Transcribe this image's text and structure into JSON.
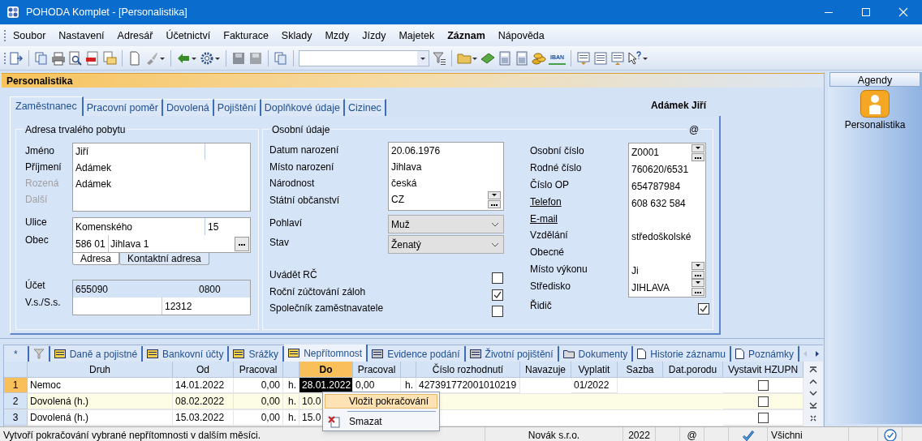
{
  "window": {
    "title": "POHODA Komplet - [Personalistika]"
  },
  "menu": [
    {
      "label": "Soubor",
      "bold": false
    },
    {
      "label": "Nastavení",
      "bold": false
    },
    {
      "label": "Adresář",
      "bold": false
    },
    {
      "label": "Účetnictví",
      "bold": false
    },
    {
      "label": "Fakturace",
      "bold": false
    },
    {
      "label": "Sklady",
      "bold": false
    },
    {
      "label": "Mzdy",
      "bold": false
    },
    {
      "label": "Jízdy",
      "bold": false
    },
    {
      "label": "Majetek",
      "bold": false
    },
    {
      "label": "Záznam",
      "bold": true
    },
    {
      "label": "Nápověda",
      "bold": false
    }
  ],
  "toolbar": {
    "iban": "IBAN"
  },
  "module_title": "Personalistika",
  "tabs": [
    {
      "label": "Zaměstnanec",
      "selected": true
    },
    {
      "label": "Pracovní poměr",
      "selected": false
    },
    {
      "label": "Dovolená",
      "selected": false
    },
    {
      "label": "Pojištění",
      "selected": false
    },
    {
      "label": "Doplňkové údaje",
      "selected": false
    },
    {
      "label": "Cizinec",
      "selected": false
    }
  ],
  "employee_name": "Adámek Jiří",
  "address": {
    "title": "Adresa trvalého pobytu",
    "name_fields": [
      {
        "label": "Jméno",
        "value": "Jiří",
        "disabled": false
      },
      {
        "label": "Příjmení",
        "value": "Adámek",
        "disabled": false
      },
      {
        "label": "Rozená",
        "value": "Adámek",
        "disabled": true
      },
      {
        "label": "Další",
        "disabled": true
      }
    ],
    "street": {
      "label": "Ulice",
      "value": "Komenského",
      "number": "15"
    },
    "city": {
      "label": "Obec",
      "zip": "586 01",
      "value": "Jihlava 1"
    },
    "tabs": [
      {
        "label": "Adresa",
        "selected": true
      },
      {
        "label": "Kontaktní adresa",
        "selected": false
      }
    ],
    "account": {
      "label": "Účet",
      "value": "655090",
      "bank_code": "0800"
    },
    "symbols": {
      "label": "V.s./S.s.",
      "specific": "12312"
    }
  },
  "personal": {
    "title": "Osobní údaje",
    "email_mark": "@",
    "fields": [
      {
        "label": "Datum narození",
        "value": "20.06.1976"
      },
      {
        "label": "Místo narození",
        "value": "Jihlava"
      },
      {
        "label": "Národnost",
        "value": "česká"
      },
      {
        "label": "Státní občanství",
        "value": "CZ"
      }
    ],
    "selects": [
      {
        "label": "Pohlaví",
        "value": "Muž"
      },
      {
        "label": "Stav",
        "value": "Ženatý"
      }
    ],
    "checks": [
      {
        "label": "Uvádět RČ",
        "checked": false
      },
      {
        "label": "Roční zúčtování záloh",
        "checked": true
      },
      {
        "label": "Společník zaměstnavatele",
        "checked": false
      }
    ]
  },
  "ids": {
    "fields": [
      {
        "label": "Osobní číslo",
        "value": "Z0001",
        "link": false,
        "lookup": true
      },
      {
        "label": "Rodné číslo",
        "value": "760620/6531",
        "link": false,
        "lookup": false
      },
      {
        "label": "Číslo OP",
        "value": "654787984",
        "link": false,
        "lookup": false
      },
      {
        "label": "Telefon",
        "value": "608 632 584",
        "link": true,
        "lookup": false
      },
      {
        "label": "E-mail",
        "link": true,
        "lookup": false
      },
      {
        "label": "Vzdělání",
        "value": "středoškolské",
        "link": false,
        "lookup": false
      },
      {
        "label": "Obecné",
        "link": false,
        "lookup": false
      },
      {
        "label": "Místo výkonu",
        "value": "Ji",
        "link": false,
        "lookup": true
      },
      {
        "label": "Středisko",
        "value": "JIHLAVA",
        "link": false,
        "lookup": true
      }
    ],
    "driver": {
      "label": "Řidič",
      "checked": true
    }
  },
  "records": {
    "tabs": [
      {
        "kind": "new",
        "label": "*",
        "selected": false
      },
      {
        "kind": "filter",
        "selected": false
      },
      {
        "kind": "table",
        "label": "Daně a pojistné",
        "selected": false
      },
      {
        "kind": "table",
        "label": "Bankovní účty",
        "selected": false
      },
      {
        "kind": "table",
        "label": "Srážky",
        "selected": false
      },
      {
        "kind": "table",
        "label": "Nepřítomnost",
        "selected": true
      },
      {
        "kind": "form",
        "label": "Evidence podání",
        "selected": false
      },
      {
        "kind": "form",
        "label": "Životní pojištění",
        "selected": false
      },
      {
        "kind": "folder",
        "label": "Dokumenty",
        "selected": false
      },
      {
        "kind": "page",
        "label": "Historie záznamu",
        "selected": false
      },
      {
        "kind": "page",
        "label": "Poznámky",
        "selected": false
      }
    ],
    "columns": [
      {
        "label": "Druh",
        "selected": false
      },
      {
        "label": "Od",
        "selected": false
      },
      {
        "label": "Pracoval",
        "selected": false
      },
      {
        "selected": false
      },
      {
        "label": "Do",
        "selected": true
      },
      {
        "label": "Pracoval",
        "selected": false
      },
      {
        "selected": false
      },
      {
        "label": "Číslo rozhodnutí",
        "selected": false
      },
      {
        "label": "Navazuje",
        "selected": false
      },
      {
        "label": "Vyplatit",
        "selected": false
      },
      {
        "label": "Sazba",
        "selected": false
      },
      {
        "label": "Dat.porodu",
        "selected": false
      },
      {
        "label": "Vystavit HZUPN",
        "selected": false
      }
    ],
    "rows": [
      {
        "number": "1",
        "selected": true,
        "cells": [
          "Nemoc",
          "14.01.2022",
          "0,00",
          "h.",
          "28.01.2022",
          "0,00",
          "h.",
          "427391772001010219",
          null,
          "01/2022",
          null,
          null
        ],
        "hzupn": false
      },
      {
        "number": "2",
        "selected": false,
        "cells": [
          "Dovolená (h.)",
          "08.02.2022",
          "0,00",
          "h.",
          "10.0",
          null,
          null,
          null,
          null,
          null,
          null,
          null
        ],
        "hzupn": false
      },
      {
        "number": "3",
        "selected": false,
        "cells": [
          "Dovolená (h.)",
          "15.03.2022",
          "0,00",
          "h.",
          "15.0",
          null,
          null,
          null,
          null,
          null,
          null,
          null
        ],
        "hzupn": false
      }
    ]
  },
  "context_menu": {
    "items": [
      {
        "kind": "text",
        "label": "Vložit pokračování",
        "selected": true
      },
      {
        "kind": "separator"
      },
      {
        "kind": "delete",
        "label": "Smazat",
        "selected": false
      }
    ]
  },
  "status_bar": {
    "hint": "Vytvoří pokračování vybrané nepřítomnosti v dalším měsíci.",
    "company": "Novák s.r.o.",
    "year": "2022",
    "mail": "@",
    "filter": "Všichni"
  },
  "agendas": {
    "title": "Agendy",
    "items": [
      {
        "label": "Personalistika"
      }
    ]
  }
}
